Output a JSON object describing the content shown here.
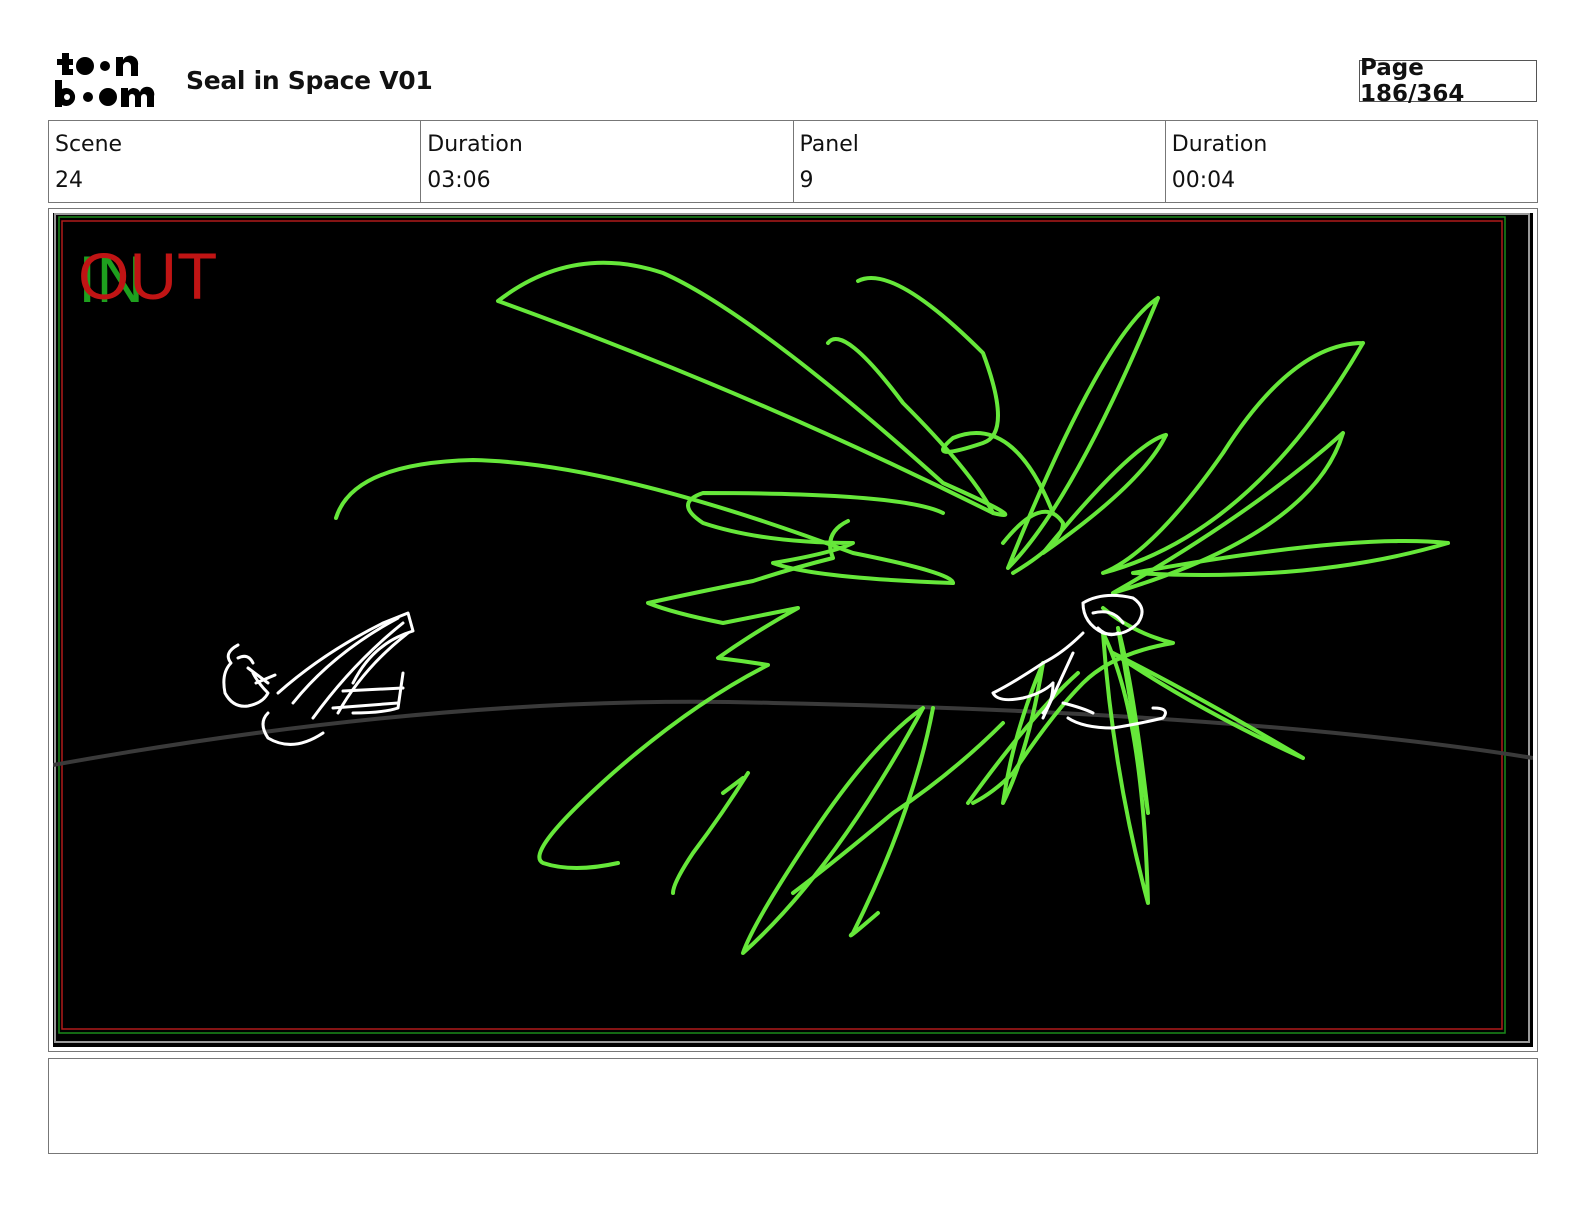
{
  "header": {
    "logo_text": "toon boom",
    "title": "Seal in Space V01",
    "page_indicator": "Page 186/364"
  },
  "info": [
    {
      "label": "Scene",
      "value": "24"
    },
    {
      "label": "Duration",
      "value": "03:06"
    },
    {
      "label": "Panel",
      "value": "9"
    },
    {
      "label": "Duration",
      "value": "00:04"
    }
  ],
  "panel": {
    "in_marker": "IN",
    "out_marker": "OUT",
    "background": "#000000",
    "sketch_color": "#66e83a",
    "in_color": "#1ea01e",
    "out_color": "#c01414"
  },
  "notes": {
    "text": ""
  }
}
